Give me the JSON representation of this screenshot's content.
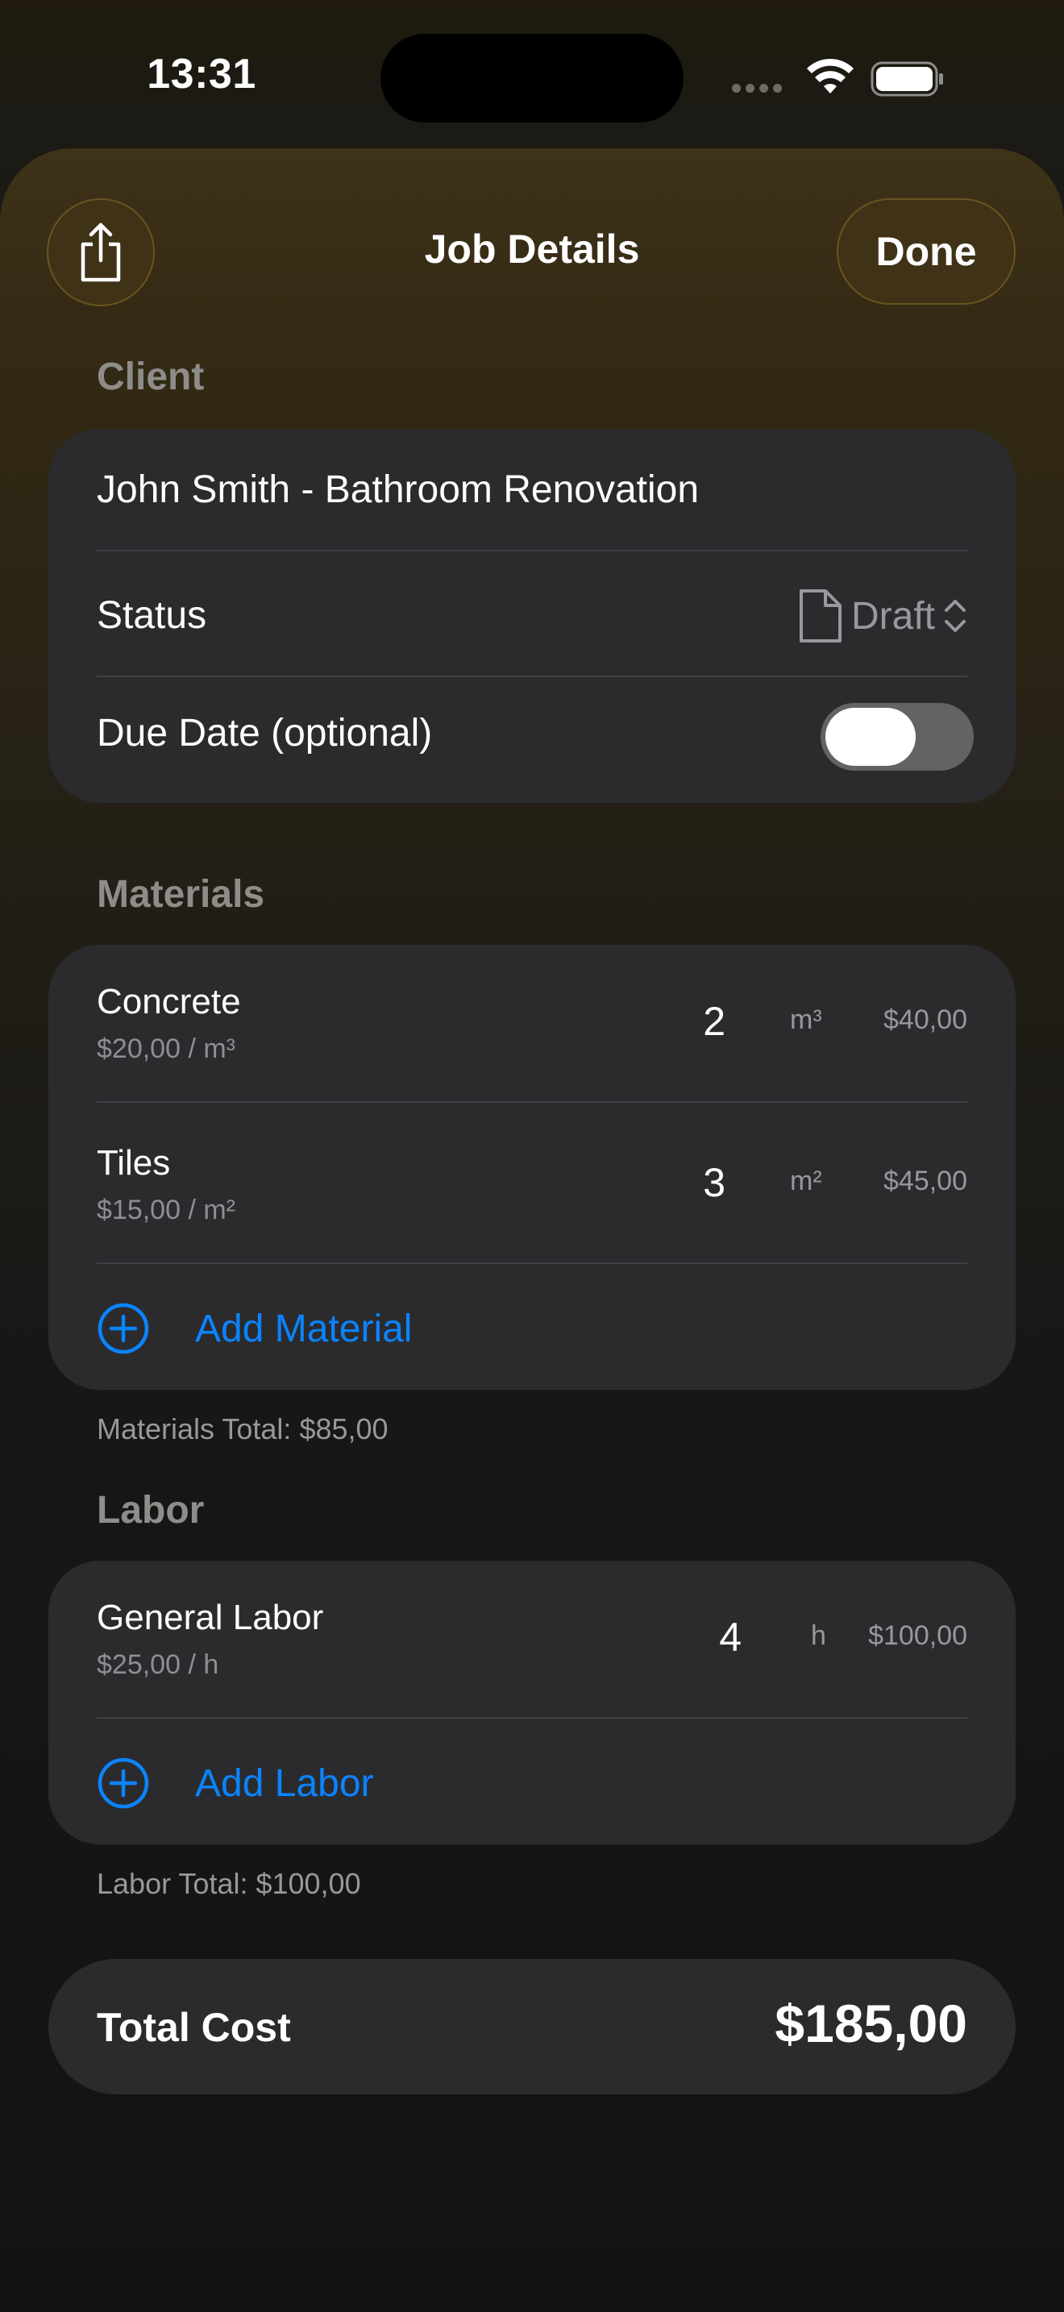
{
  "status_bar": {
    "time": "13:31"
  },
  "nav": {
    "title": "Job Details",
    "done_label": "Done"
  },
  "client": {
    "header": "Client",
    "job_name": "John Smith - Bathroom Renovation",
    "status_label": "Status",
    "status_value": "Draft",
    "due_date_label": "Due Date (optional)",
    "due_date_enabled": false
  },
  "materials": {
    "header": "Materials",
    "items": [
      {
        "name": "Concrete",
        "unit_price": "$20,00 / m³",
        "quantity": "2",
        "unit": "m³",
        "total": "$40,00"
      },
      {
        "name": "Tiles",
        "unit_price": "$15,00 / m²",
        "quantity": "3",
        "unit": "m²",
        "total": "$45,00"
      }
    ],
    "add_label": "Add Material",
    "total_text": "Materials Total: $85,00"
  },
  "labor": {
    "header": "Labor",
    "items": [
      {
        "name": "General Labor",
        "unit_price": "$25,00 / h",
        "quantity": "4",
        "unit": "h",
        "total": "$100,00"
      }
    ],
    "add_label": "Add Labor",
    "total_text": "Labor Total: $100,00"
  },
  "summary": {
    "label": "Total Cost",
    "value": "$185,00"
  },
  "colors": {
    "accent": "#0a84ff",
    "card": "#2b2b2e",
    "nav_button": "#3f3216"
  }
}
